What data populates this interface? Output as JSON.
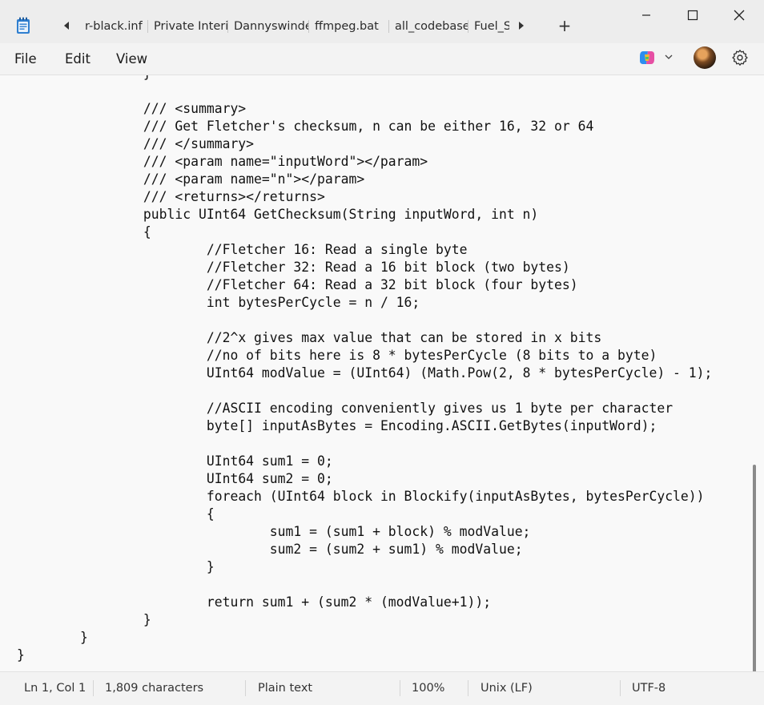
{
  "window": {
    "app_icon": "notepad-icon",
    "minimize_icon": "minimize-icon",
    "maximize_icon": "maximize-icon",
    "close_icon": "close-icon"
  },
  "tabs": [
    {
      "label": "r-black.inf"
    },
    {
      "label": "Private Interi"
    },
    {
      "label": "Dannyswindé"
    },
    {
      "label": "ffmpeg.bat"
    },
    {
      "label": "all_codebase"
    },
    {
      "label": "Fuel_S"
    }
  ],
  "tab_controls": {
    "scroll_left_icon": "chevron-left-icon",
    "scroll_right_icon": "chevron-right-icon",
    "new_tab_label": "+"
  },
  "menu": {
    "file": "File",
    "edit": "Edit",
    "view": "View"
  },
  "toolbar": {
    "copilot_icon": "copilot-icon",
    "avatar": "user-avatar",
    "settings_icon": "gear-icon"
  },
  "code_lines": [
    "\t\t}",
    "",
    "\t\t/// <summary>",
    "\t\t/// Get Fletcher's checksum, n can be either 16, 32 or 64",
    "\t\t/// </summary>",
    "\t\t/// <param name=\"inputWord\"></param>",
    "\t\t/// <param name=\"n\"></param>",
    "\t\t/// <returns></returns>",
    "\t\tpublic UInt64 GetChecksum(String inputWord, int n)",
    "\t\t{",
    "\t\t\t//Fletcher 16: Read a single byte",
    "\t\t\t//Fletcher 32: Read a 16 bit block (two bytes)",
    "\t\t\t//Fletcher 64: Read a 32 bit block (four bytes)",
    "\t\t\tint bytesPerCycle = n / 16;",
    "",
    "\t\t\t//2^x gives max value that can be stored in x bits",
    "\t\t\t//no of bits here is 8 * bytesPerCycle (8 bits to a byte)",
    "\t\t\tUInt64 modValue = (UInt64) (Math.Pow(2, 8 * bytesPerCycle) - 1);",
    "",
    "\t\t\t//ASCII encoding conveniently gives us 1 byte per character",
    "\t\t\tbyte[] inputAsBytes = Encoding.ASCII.GetBytes(inputWord);",
    "",
    "\t\t\tUInt64 sum1 = 0;",
    "\t\t\tUInt64 sum2 = 0;",
    "\t\t\tforeach (UInt64 block in Blockify(inputAsBytes, bytesPerCycle))",
    "\t\t\t{",
    "\t\t\t\tsum1 = (sum1 + block) % modValue;",
    "\t\t\t\tsum2 = (sum2 + sum1) % modValue;",
    "\t\t\t}",
    "",
    "\t\t\treturn sum1 + (sum2 * (modValue+1));",
    "\t\t}",
    "\t}",
    "}"
  ],
  "status": {
    "position": "Ln 1, Col 1",
    "characters": "1,809 characters",
    "format": "Plain text",
    "zoom": "100%",
    "line_ending": "Unix (LF)",
    "encoding": "UTF-8"
  }
}
